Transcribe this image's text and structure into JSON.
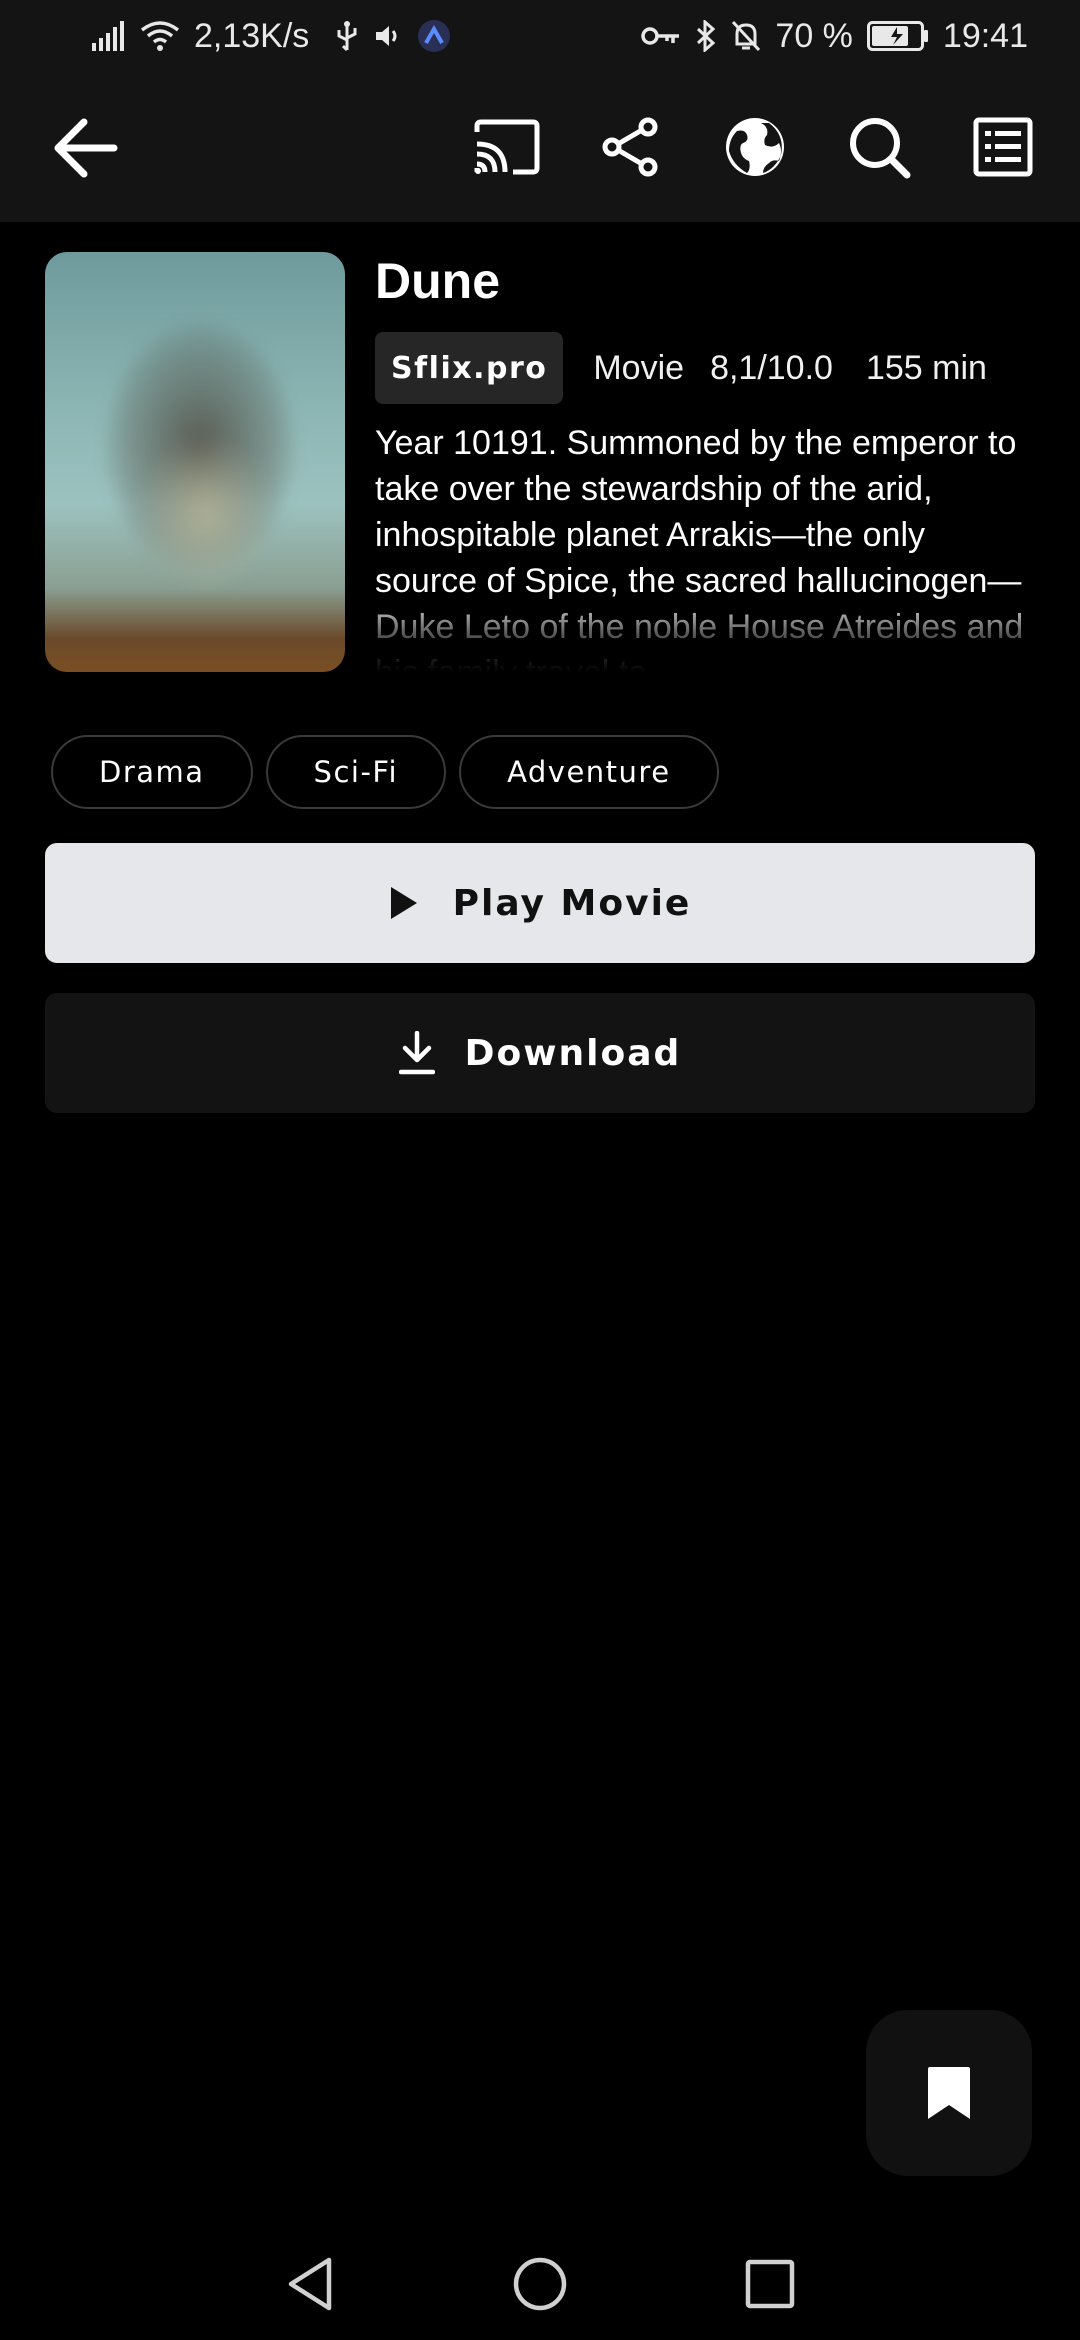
{
  "status_bar": {
    "net_speed": "2,13K/s",
    "battery": "70 %",
    "time": "19:41",
    "icons": [
      "signal-icon",
      "wifi-icon",
      "usb-icon",
      "volume-icon",
      "vpn-app-icon",
      "key-icon",
      "bluetooth-icon",
      "bell-off-icon",
      "battery-icon"
    ]
  },
  "app_bar": {
    "icons": [
      "back-arrow-icon",
      "cast-icon",
      "share-icon",
      "globe-icon",
      "search-icon",
      "list-icon"
    ]
  },
  "movie": {
    "title": "Dune",
    "provider": "Sflix.pro",
    "type": "Movie",
    "rating": "8,1/10.0",
    "duration": "155 min",
    "description": "Year 10191. Summoned by the emperor to take over the stewardship of the arid, inhospitable planet Arrakis—the only source of Spice, the sacred hallucinogen—Duke Leto of the noble House Atreides and his family travel to"
  },
  "genres": [
    "Drama",
    "Sci-Fi",
    "Adventure"
  ],
  "buttons": {
    "play_label": "Play Movie",
    "download_label": "Download"
  },
  "colors": {
    "background": "#000000",
    "bar": "#141414",
    "play_button": "#e6e7eb",
    "download_button": "#131313"
  }
}
